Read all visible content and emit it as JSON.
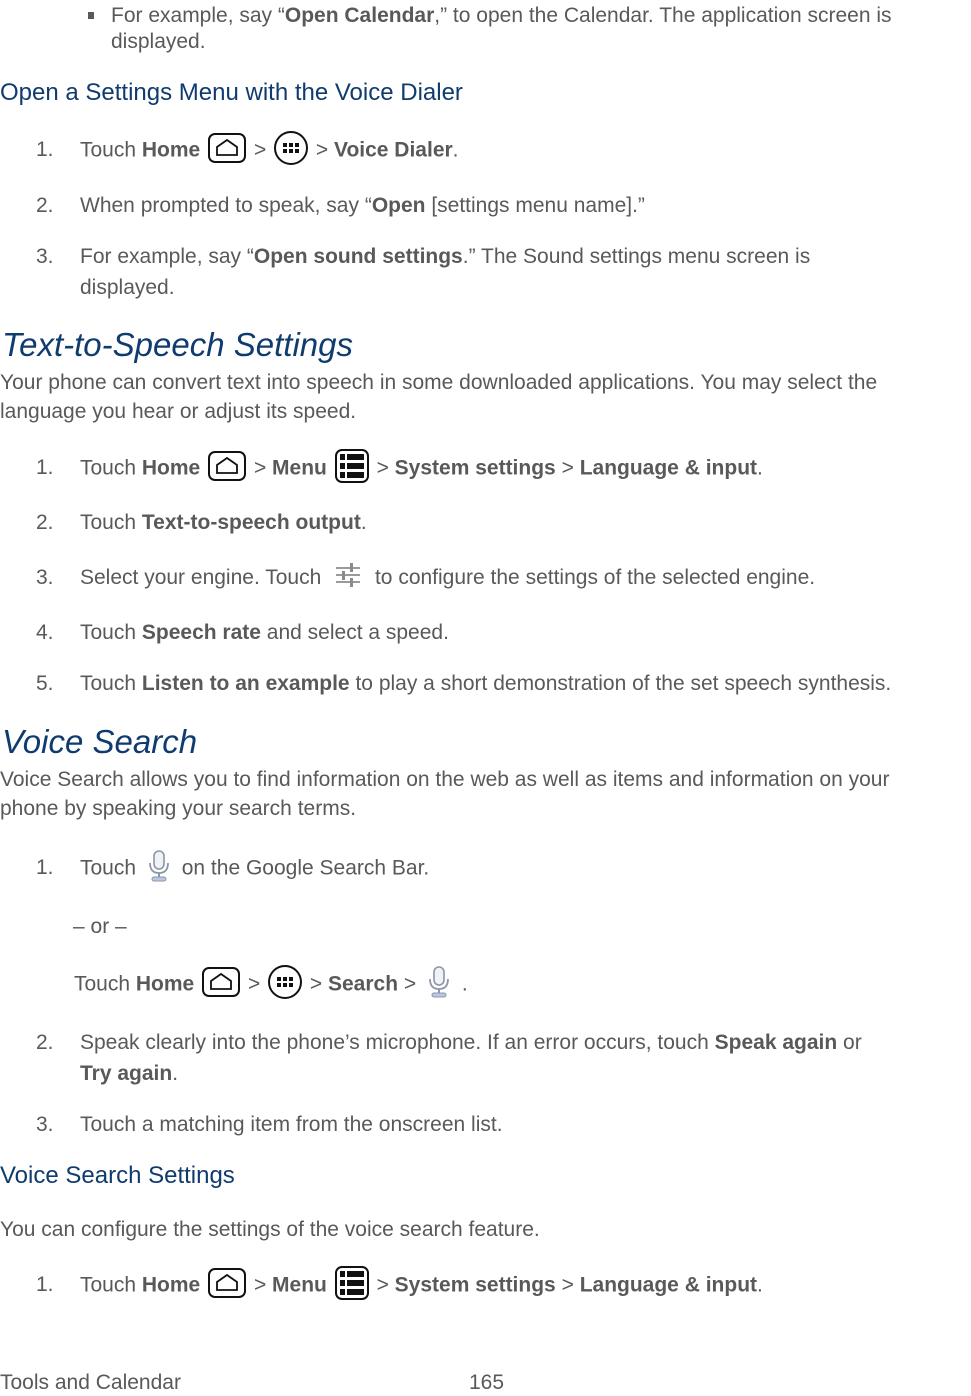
{
  "intro_bullet": {
    "prefix": "For example, say “",
    "bold": "Open Calendar",
    "suffix": ",” to open the Calendar. The application screen is",
    "line2": "displayed."
  },
  "section_open_settings": {
    "heading": "Open a Settings Menu with the Voice Dialer",
    "steps": [
      {
        "num": "1.",
        "touch": "Touch",
        "home": "Home",
        "sep1": ">",
        "sep2": ">",
        "voice_dialer": "Voice Dialer",
        "end": "."
      },
      {
        "num": "2.",
        "prefix": "When prompted to speak, say “",
        "bold": "Open",
        "suffix": " [settings menu name].”"
      },
      {
        "num": "3.",
        "prefix": "For example, say “",
        "bold": "Open sound settings",
        "suffix": ".” The Sound settings menu screen is",
        "line2": "displayed."
      }
    ]
  },
  "section_tts": {
    "heading": "Text-to-Speech Settings",
    "intro_line1": "Your phone can convert text into speech in some downloaded applications. You may select the",
    "intro_line2": "language you hear or adjust its speed.",
    "steps": [
      {
        "num": "1.",
        "touch": "Touch",
        "home": "Home",
        "sep1": ">",
        "menu": "Menu",
        "sep2": ">",
        "system_settings": "System settings",
        "sep3": ">",
        "language_input": "Language & input",
        "end": "."
      },
      {
        "num": "2.",
        "touch": "Touch",
        "bold": "Text-to-speech output",
        "end": "."
      },
      {
        "num": "3.",
        "prefix": "Select your engine. Touch",
        "suffix": "to configure the settings of the selected engine."
      },
      {
        "num": "4.",
        "touch": "Touch",
        "bold": "Speech rate",
        "suffix": "and select a speed."
      },
      {
        "num": "5.",
        "touch": "Touch",
        "bold": "Listen to an example",
        "suffix": "to play a short demonstration of the set speech synthesis."
      }
    ]
  },
  "section_voice_search": {
    "heading": "Voice Search",
    "intro_line1": "Voice Search allows you to find information on the web as well as items and information on your",
    "intro_line2": "phone by speaking your search terms.",
    "steps": [
      {
        "num": "1.",
        "touch": "Touch",
        "suffix": "on the Google Search Bar.",
        "or": "– or –",
        "alt_touch": "Touch",
        "alt_home": "Home",
        "alt_sep1": ">",
        "alt_sep2": ">",
        "alt_search": "Search",
        "alt_sep3": ">",
        "alt_end": "."
      },
      {
        "num": "2.",
        "prefix": "Speak clearly into the phone’s microphone. If an error occurs, touch",
        "bold1": "Speak again",
        "mid": "or",
        "bold2": "Try again",
        "end": "."
      },
      {
        "num": "3.",
        "text": "Touch a matching item from the onscreen list."
      }
    ]
  },
  "section_voice_search_settings": {
    "heading": "Voice Search Settings",
    "intro": "You can configure the settings of the voice search feature.",
    "steps": [
      {
        "num": "1.",
        "touch": "Touch",
        "home": "Home",
        "sep1": ">",
        "menu": "Menu",
        "sep2": ">",
        "system_settings": "System settings",
        "sep3": ">",
        "language_input": "Language & input",
        "end": "."
      }
    ]
  },
  "footer": {
    "chapter": "Tools and Calendar",
    "page_number": "165"
  },
  "icons": {
    "home": "home-icon",
    "apps": "apps-icon",
    "menu": "menu-icon",
    "settings": "settings-sliders-icon",
    "mic": "microphone-icon"
  },
  "colors": {
    "heading": "#0f3b6e",
    "body_text": "#595959",
    "mic_tint": "#b8c8e0"
  }
}
